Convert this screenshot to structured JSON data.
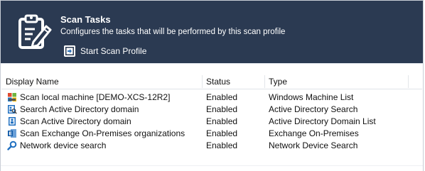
{
  "header": {
    "title": "Scan Tasks",
    "description": "Configures the tasks that will be performed by this scan profile",
    "start_link": "Start Scan Profile",
    "background": "#2b3a52",
    "icon": "clipboard-pencil-icon",
    "start_icon": "arrow-into-box-icon"
  },
  "table": {
    "columns": [
      "Display Name",
      "Status",
      "Type"
    ],
    "rows": [
      {
        "name": "Scan local machine [DEMO-XCS-12R2]",
        "status": "Enabled",
        "type": "Windows Machine List",
        "icon": "windows-machine-icon"
      },
      {
        "name": "Search Active Directory domain",
        "status": "Enabled",
        "type": "Active Directory Search",
        "icon": "ad-search-icon"
      },
      {
        "name": "Scan Active Directory domain",
        "status": "Enabled",
        "type": "Active Directory Domain List",
        "icon": "ad-domain-icon"
      },
      {
        "name": "Scan Exchange On-Premises organizations",
        "status": "Enabled",
        "type": "Exchange On-Premises",
        "icon": "exchange-icon"
      },
      {
        "name": "Network device search",
        "status": "Enabled",
        "type": "Network Device Search",
        "icon": "network-search-icon"
      }
    ]
  }
}
